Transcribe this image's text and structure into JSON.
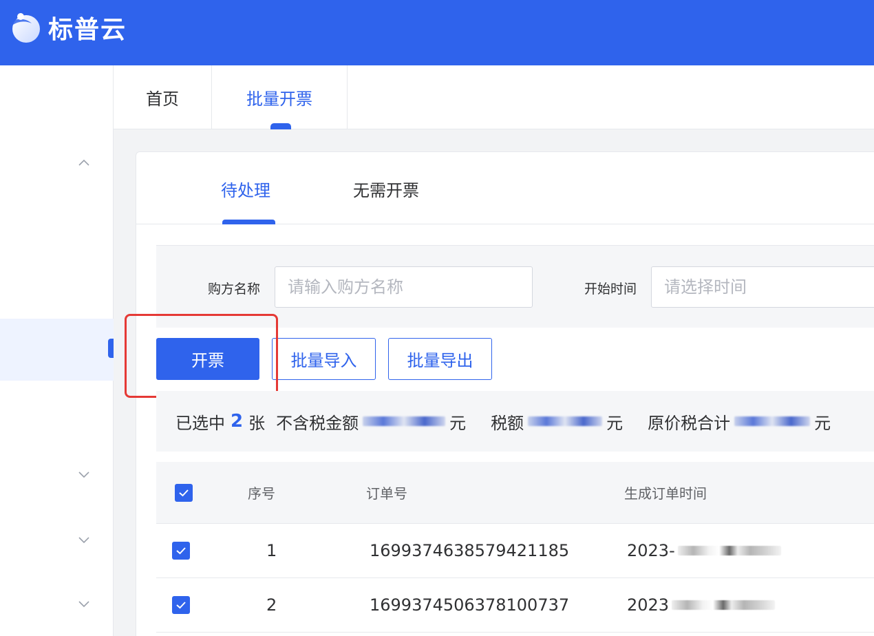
{
  "header": {
    "brand": "标普云"
  },
  "tabs": [
    {
      "label": "首页",
      "active": false
    },
    {
      "label": "批量开票",
      "active": true
    }
  ],
  "subtabs": [
    {
      "label": "待处理",
      "active": true
    },
    {
      "label": "无需开票",
      "active": false
    }
  ],
  "filters": {
    "buyer_label": "购方名称",
    "buyer_placeholder": "请输入购方名称",
    "start_label": "开始时间",
    "start_placeholder": "请选择时间"
  },
  "actions": {
    "issue": "开票",
    "import": "批量导入",
    "export": "批量导出"
  },
  "summary": {
    "selected_prefix": "已选中",
    "selected_count": "2",
    "selected_unit": "张",
    "amount_label": "不含税金额",
    "tax_label": "税额",
    "total_label": "原价税合计",
    "currency": "元"
  },
  "table": {
    "columns": [
      "序号",
      "订单号",
      "生成订单时间"
    ],
    "rows": [
      {
        "index": "1",
        "order_no": "1699374638579421185",
        "time": "2023-",
        "checked": true
      },
      {
        "index": "2",
        "order_no": "1699374506378100737",
        "time": "2023",
        "checked": true
      }
    ]
  },
  "colors": {
    "primary": "#2f63ec",
    "highlight": "#e53935"
  }
}
